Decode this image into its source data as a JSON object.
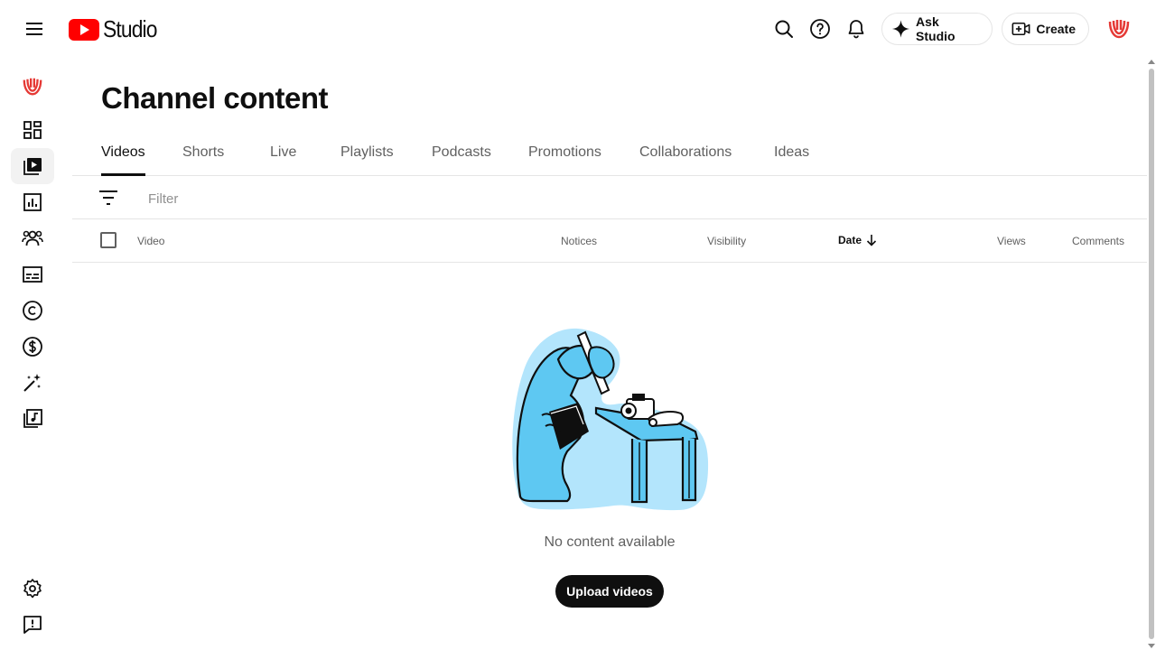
{
  "header": {
    "logo_text": "Studio",
    "ask_studio_label": "Ask Studio",
    "create_label": "Create"
  },
  "page": {
    "title": "Channel content"
  },
  "tabs": [
    {
      "label": "Videos",
      "active": true
    },
    {
      "label": "Shorts"
    },
    {
      "label": "Live"
    },
    {
      "label": "Playlists"
    },
    {
      "label": "Podcasts"
    },
    {
      "label": "Promotions"
    },
    {
      "label": "Collaborations"
    },
    {
      "label": "Ideas"
    }
  ],
  "filter": {
    "placeholder": "Filter"
  },
  "table": {
    "columns": {
      "video": "Video",
      "notices": "Notices",
      "visibility": "Visibility",
      "date": "Date",
      "views": "Views",
      "comments": "Comments"
    },
    "sorted_column": "date",
    "sort_direction": "descending"
  },
  "empty_state": {
    "message": "No content available",
    "button_label": "Upload videos"
  },
  "sidebar": {
    "items": [
      {
        "icon": "channel-avatar-icon"
      },
      {
        "icon": "dashboard-icon"
      },
      {
        "icon": "content-icon",
        "active": true
      },
      {
        "icon": "analytics-icon"
      },
      {
        "icon": "community-icon"
      },
      {
        "icon": "subtitles-icon"
      },
      {
        "icon": "copyright-icon"
      },
      {
        "icon": "earn-icon"
      },
      {
        "icon": "customization-icon"
      },
      {
        "icon": "audio-library-icon"
      },
      {
        "icon": "settings-icon"
      },
      {
        "icon": "feedback-icon"
      }
    ]
  },
  "colors": {
    "brand_red": "#ff0000",
    "text_primary": "#0f0f0f",
    "text_secondary": "#606060",
    "illustration_blue": "#5ec8f2"
  }
}
